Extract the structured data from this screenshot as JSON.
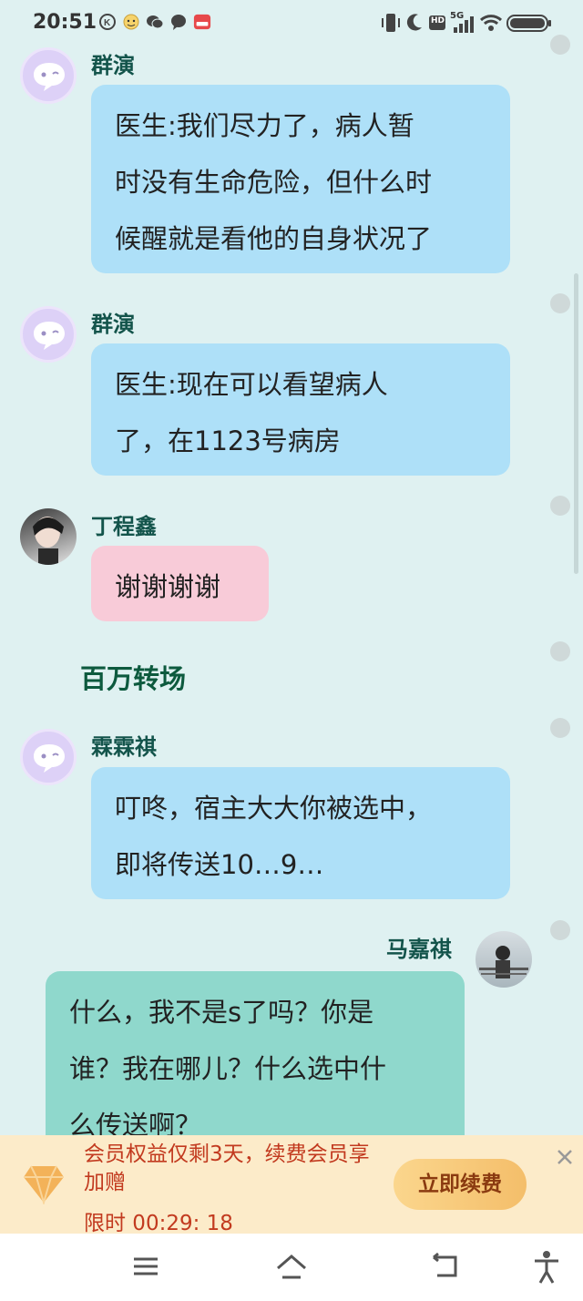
{
  "status_bar": {
    "time": "20:51",
    "network": "5G",
    "hd_label": "HD",
    "notification_icons": [
      "k-icon",
      "emoji-icon",
      "wechat-icon",
      "chat-bubble-icon",
      "app-badge-icon"
    ],
    "right_icons": [
      "vibrate-icon",
      "moon-icon",
      "hd-icon",
      "signal-icon",
      "wifi-icon",
      "battery-icon"
    ]
  },
  "chat": {
    "messages": [
      {
        "sender": "群演",
        "side": "left",
        "avatar": "bot-avatar",
        "bubble_color": "#aee0f8",
        "lines": [
          "医生:我们尽力了，病人暂",
          "时没有生命危险，但什么时",
          "候醒就是看他的自身状况了"
        ]
      },
      {
        "sender": "群演",
        "side": "left",
        "avatar": "bot-avatar",
        "bubble_color": "#aee0f8",
        "lines": [
          "医生:现在可以看望病人",
          "了，在1123号病房"
        ]
      },
      {
        "sender": "丁程鑫",
        "side": "left",
        "avatar": "photo-avatar",
        "bubble_color": "#f8cbd8",
        "lines": [
          "谢谢谢谢"
        ]
      },
      {
        "sender": "霖霖祺",
        "side": "left",
        "avatar": "bot-avatar",
        "bubble_color": "#aee0f8",
        "lines": [
          "叮咚，宿主大大你被选中，",
          "即将传送10…9…"
        ]
      },
      {
        "sender": "马嘉祺",
        "side": "right",
        "avatar": "photo-avatar",
        "bubble_color": "#8fd8cc",
        "lines": [
          "什么，我不是s了吗？你是",
          "谁？我在哪儿？什么选中什",
          "么传送啊？"
        ]
      }
    ],
    "narration": "百万转场"
  },
  "promo": {
    "text": "会员权益仅剩3天，续费会员享加赠",
    "timer": "限时 00:29: 18",
    "button": "立即续费",
    "icon": "diamond-icon",
    "accent": "#c23a1f"
  },
  "nav_bar": {
    "icons": [
      "menu-icon",
      "home-icon",
      "back-icon",
      "accessibility-icon"
    ]
  }
}
